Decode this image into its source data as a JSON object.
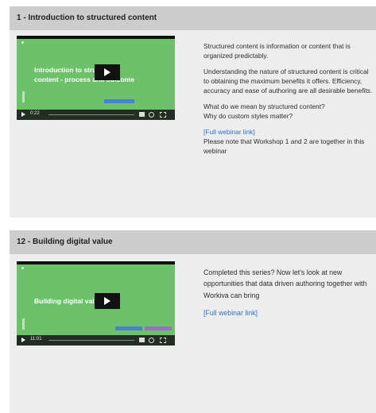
{
  "webinars": [
    {
      "title": "1 - Introduction to structured content",
      "video_title_line1": "Introduction to structured",
      "video_title_line2": "content - process and outcome",
      "video_time": "0:22",
      "paragraph1": "Structured content is information or content that is organized predictably.",
      "paragraph2": "Understanding the nature of structured content is critical to obtaining the maximum benefits it offers. Efficiency, accuracy and ease of authoring are all desirable benefits.",
      "question1": "What do we mean by structured content?",
      "question2": "Why do custom styles matter?",
      "link_label": "[Full webinar link]",
      "note": "Please note that Workshop 1 and 2 are together in this webinar"
    },
    {
      "title": "12 - Building digital value",
      "video_title_line1": "Building digital value",
      "video_time": "11:01",
      "paragraph1": "Completed this series? Now let's look at new opportunities that data driven authoring together with Workiva can bring",
      "link_label": "[Full webinar link]"
    }
  ],
  "colors": {
    "video_bg": "#6cc16a",
    "header_bg": "#cdcdcd",
    "card_bg": "#ededed",
    "link": "#2f72c4",
    "badge_blue": "#4a7fd4",
    "badge_purple": "#9a6fc2"
  },
  "icons": [
    "play-icon",
    "volume-icon",
    "settings-icon",
    "fullscreen-icon",
    "brand-logo-icon"
  ]
}
